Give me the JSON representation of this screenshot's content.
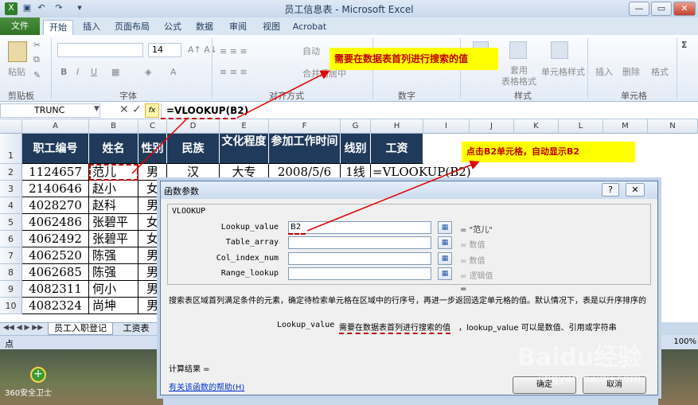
{
  "window": {
    "title": "员工信息表 - Microsoft Excel",
    "min_label": "—",
    "max_label": "▭",
    "close_label": "✕"
  },
  "ribbon": {
    "tabs": [
      "文件",
      "开始",
      "插入",
      "页面布局",
      "公式",
      "数据",
      "审阅",
      "视图",
      "Acrobat"
    ],
    "paste_label": "粘贴",
    "clipboard_label": "剪贴板",
    "font_label": "字体",
    "font_size": "14",
    "align_label": "对齐方式",
    "wrap_text": "自动",
    "merge_center": "合并后居中",
    "number_label": "数字",
    "format_table": "套用\n表格格式",
    "cell_styles": "单元格样式",
    "styles_label": "样式",
    "insert_label": "插入",
    "delete_label": "删除",
    "format_label": "格式",
    "cells_label": "单元格"
  },
  "formula_bar": {
    "name_box": "TRUNC",
    "fx": "fx",
    "formula": "=VLOOKUP(B2)"
  },
  "columns": [
    "A",
    "B",
    "C",
    "D",
    "E",
    "F",
    "G",
    "H",
    "I",
    "J",
    "K",
    "L",
    "M",
    "N"
  ],
  "header_row": [
    "职工编号",
    "姓名",
    "性别",
    "民族",
    "文化程度",
    "参加工作时间",
    "线别",
    "工资"
  ],
  "rows": [
    {
      "num": "2",
      "id": "1124657",
      "name": "范儿",
      "sex": "男",
      "nation": "汉",
      "edu": "大专",
      "date": "2008/5/6",
      "line": "1线",
      "h": "=VLOOKUP(B2)"
    },
    {
      "num": "3",
      "id": "2140646",
      "name": "赵小",
      "sex": "女"
    },
    {
      "num": "4",
      "id": "4028270",
      "name": "赵科",
      "sex": "男"
    },
    {
      "num": "5",
      "id": "4062486",
      "name": "张碧平",
      "sex": "女"
    },
    {
      "num": "6",
      "id": "4062492",
      "name": "张碧平",
      "sex": "女"
    },
    {
      "num": "7",
      "id": "4062520",
      "name": "陈强",
      "sex": "男"
    },
    {
      "num": "8",
      "id": "4062685",
      "name": "陈强",
      "sex": "男"
    },
    {
      "num": "9",
      "id": "4082311",
      "name": "何小",
      "sex": "男"
    },
    {
      "num": "10",
      "id": "4082324",
      "name": "尚坤",
      "sex": "男"
    }
  ],
  "row1_num": "1",
  "sheet_tabs": [
    "员工入职登记",
    "工资表"
  ],
  "status_text": "点",
  "zoom": "100%",
  "desktop_label": "360安全卫士",
  "dialog": {
    "title": "函数参数",
    "help_btn": "?",
    "close_btn": "✕",
    "func_name": "VLOOKUP",
    "args": [
      {
        "label": "Lookup_value",
        "value": "B2",
        "result": "= \"范儿\""
      },
      {
        "label": "Table_array",
        "value": "",
        "result": "= 数值"
      },
      {
        "label": "Col_index_num",
        "value": "",
        "result": "= 数值"
      },
      {
        "label": "Range_lookup",
        "value": "",
        "result": "= 逻辑值"
      }
    ],
    "equals_line": "=",
    "description": "搜索表区域首列满足条件的元素，确定待检索单元格在区域中的行序号，再进一步返回选定单元格的值。默认情况下，表是以升序排序的",
    "arg_name": "Lookup_value",
    "arg_desc_hl": "需要在数据表首列进行搜索的值",
    "arg_desc_rest": "，lookup_value 可以是数值、引用或字符串",
    "calc_result": "计算结果 =",
    "help_link": "有关该函数的帮助(H)",
    "ok": "确定",
    "cancel": "取消"
  },
  "callouts": {
    "top": "需要在数据表首列进行搜索的值",
    "right": "点击B2单元格，自动显示B2"
  },
  "watermark": "Baidu经验",
  "watermark_sub": "jingyan.baidu.com"
}
